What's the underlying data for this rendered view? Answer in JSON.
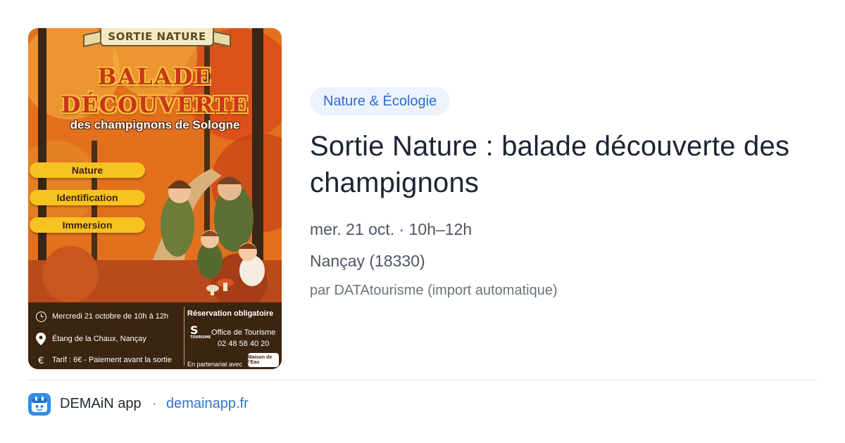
{
  "poster": {
    "banner": "SORTIE NATURE",
    "title_line1": "BALADE",
    "title_line2": "DÉCOUVERTE",
    "subtitle": "des champignons de Sologne",
    "pills": [
      "Nature",
      "Identification",
      "Immersion"
    ],
    "footer": {
      "datetime": "Mercredi 21 octobre de 10h à 12h",
      "place": "Étang de la Chaux, Nançay",
      "tarif": "Tarif : 6€ - Paiement avant la sortie",
      "reservation": "Réservation obligatoire",
      "office_line1": "Office de Tourisme",
      "office_phone": "02 48 58 40 20",
      "logo_letter": "S",
      "logo_small": "TOURISME",
      "partner": "En partenariat avec",
      "partner_logo": "Maison de l'Eau"
    }
  },
  "event": {
    "category": "Nature & Écologie",
    "title": "Sortie Nature : balade découverte des champignons",
    "date_time": "mer. 21 oct. · 10h–12h",
    "location": "Nançay (18330)",
    "source": "par DATAtourisme (import automatique)"
  },
  "footer": {
    "app_name": "DEMAiN app",
    "separator": "·",
    "domain": "demainapp.fr"
  },
  "colors": {
    "accent_blue": "#2f73cf",
    "category_bg": "#edf3fc",
    "title_text": "#1c2433",
    "poster_pill": "#f7c321"
  },
  "icons": {
    "app": "calendar-app-icon",
    "clock": "clock-icon",
    "pin": "location-pin-icon",
    "euro": "euro-icon"
  }
}
